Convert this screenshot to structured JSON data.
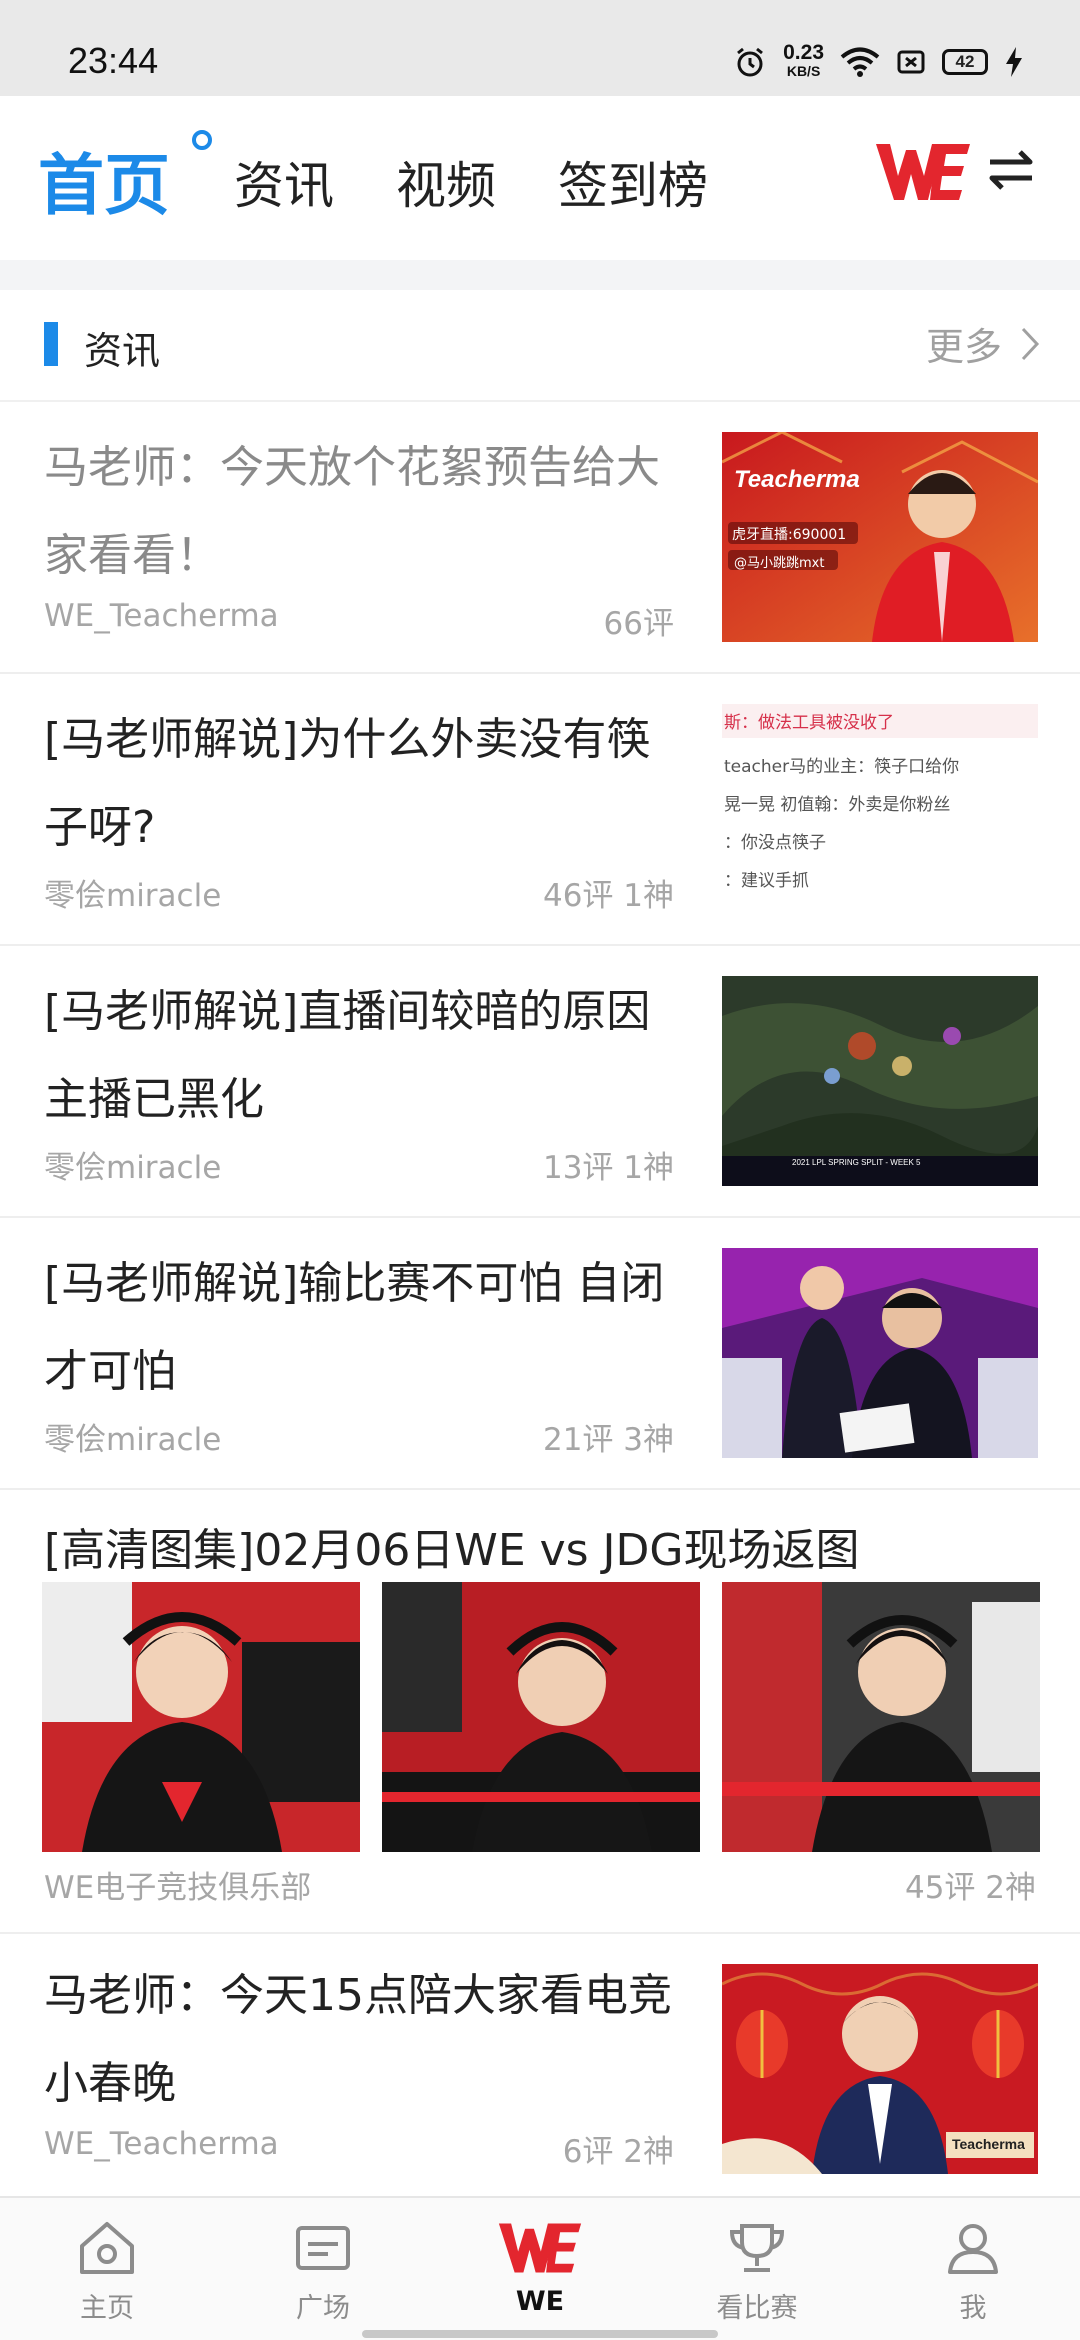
{
  "status_bar": {
    "time": "23:44",
    "net_speed_value": "0.23",
    "net_speed_unit": "KB/S",
    "battery_level": "42",
    "icons": [
      "alarm-icon",
      "wifi-icon",
      "no-sim-icon",
      "battery-icon",
      "charging-icon"
    ]
  },
  "header": {
    "tabs": [
      {
        "label": "首页",
        "active": true
      },
      {
        "label": "资讯",
        "active": false
      },
      {
        "label": "视频",
        "active": false
      },
      {
        "label": "签到榜",
        "active": false
      }
    ],
    "logo": "WE",
    "accent_color": "#1c8ae8",
    "brand_color": "#e3262e"
  },
  "section": {
    "title": "资讯",
    "more_label": "更多"
  },
  "news": [
    {
      "title": "马老师：今天放个花絮预告给大家看看！",
      "author": "WE_Teacherma",
      "stats": "66评",
      "read": true,
      "thumb_text": "Teacherma",
      "thumb_sub1": "虎牙直播:690001",
      "thumb_sub2": "@马小跳跳mxt"
    },
    {
      "title": "[马老师解说]为什么外卖没有筷子呀?",
      "author": "零侩miracle",
      "stats": "46评 1神",
      "read": false,
      "chat": [
        "斯：做法工具被没收了",
        "teacher马的业主：筷子口给你",
        "晃一晃 初值翰：外卖是你粉丝",
        "：你没点筷子",
        "：建议手抓"
      ]
    },
    {
      "title": "[马老师解说]直播间较暗的原因 主播已黑化",
      "author": "零侩miracle",
      "stats": "13评 1神",
      "read": false,
      "thumb_caption": "2021 LPL SPRING SPLIT - WEEK 5"
    },
    {
      "title": "[马老师解说]输比赛不可怕 自闭才可怕",
      "author": "零侩miracle",
      "stats": "21评 3神",
      "read": false
    }
  ],
  "gallery": {
    "title": "[高清图集]02月06日WE vs JDG现场返图",
    "author": "WE电子竞技俱乐部",
    "stats": "45评 2神",
    "images": 3
  },
  "news_last": {
    "title": "马老师：今天15点陪大家看电竞小春晚",
    "author": "WE_Teacherma",
    "stats": "6评 2神",
    "thumb_text": "Teacherma"
  },
  "bottom_nav": [
    {
      "label": "主页",
      "icon": "home-icon",
      "active": false
    },
    {
      "label": "广场",
      "icon": "square-icon",
      "active": false
    },
    {
      "label": "WE",
      "icon": "we-logo-icon",
      "active": true
    },
    {
      "label": "看比赛",
      "icon": "trophy-icon",
      "active": false
    },
    {
      "label": "我",
      "icon": "profile-icon",
      "active": false
    }
  ]
}
